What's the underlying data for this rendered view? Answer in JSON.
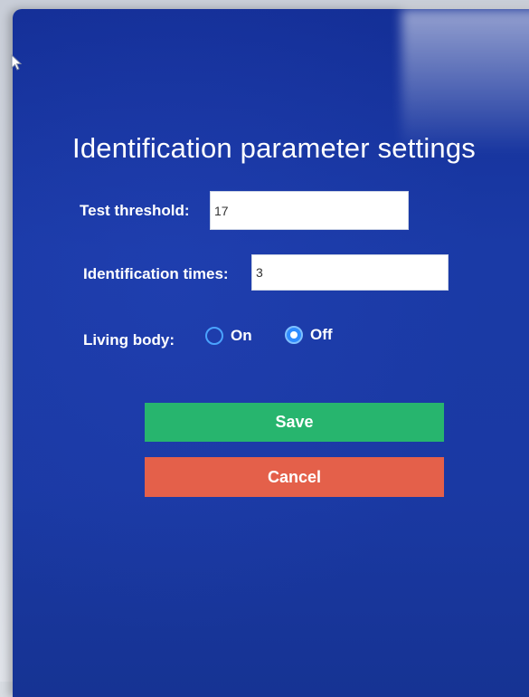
{
  "dialog": {
    "title": "Identification parameter settings"
  },
  "fields": {
    "threshold_label": "Test threshold:",
    "threshold_value": "17",
    "times_label": "Identification times:",
    "times_value": "3"
  },
  "living_body": {
    "label": "Living body:",
    "options": [
      {
        "label": "On",
        "selected": false
      },
      {
        "label": "Off",
        "selected": true
      }
    ]
  },
  "actions": {
    "save_label": "Save",
    "cancel_label": "Cancel"
  },
  "colors": {
    "screen_background": "#1a39a3",
    "save_button": "#27b56e",
    "cancel_button": "#e4604a",
    "radio_accent": "#2f8cff"
  },
  "icons": {
    "cursor": "mouse-pointer-icon"
  }
}
